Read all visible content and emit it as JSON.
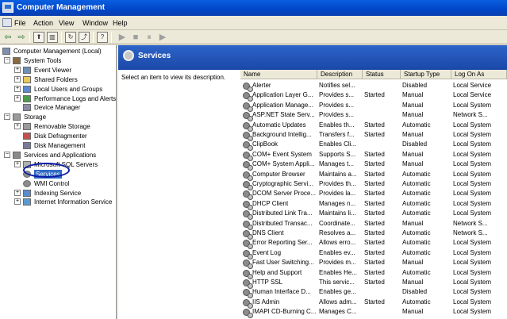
{
  "window": {
    "title": "Computer Management"
  },
  "menu": [
    "File",
    "Action",
    "View",
    "Window",
    "Help"
  ],
  "toolbar": [
    {
      "name": "back-arrow-icon",
      "glyph": "⇦"
    },
    {
      "name": "forward-arrow-icon",
      "glyph": "⇨"
    },
    {
      "name": "up-folder-icon",
      "glyph": "⬆"
    },
    {
      "name": "show-hide-tree-icon",
      "glyph": "▥"
    },
    {
      "name": "refresh-icon",
      "glyph": "↻"
    },
    {
      "name": "export-list-icon",
      "glyph": "⤴"
    },
    {
      "name": "properties-icon",
      "glyph": "?"
    },
    {
      "name": "start-service-icon",
      "glyph": "▶"
    },
    {
      "name": "stop-service-icon",
      "glyph": "■"
    },
    {
      "name": "pause-service-icon",
      "glyph": "⏸"
    },
    {
      "name": "restart-service-icon",
      "glyph": "▶"
    }
  ],
  "tree": [
    {
      "label": "Computer Management (Local)",
      "level": 0,
      "expander": "",
      "icon": "computer-icon",
      "color": "#7f8fb0"
    },
    {
      "label": "System Tools",
      "level": 1,
      "expander": "−",
      "icon": "tools-icon",
      "color": "#8b6a3c"
    },
    {
      "label": "Event Viewer",
      "level": 2,
      "expander": "+",
      "icon": "event-viewer-icon",
      "color": "#6d8fb5"
    },
    {
      "label": "Shared Folders",
      "level": 2,
      "expander": "+",
      "icon": "shared-folders-icon",
      "color": "#e8c85a"
    },
    {
      "label": "Local Users and Groups",
      "level": 2,
      "expander": "+",
      "icon": "users-icon",
      "color": "#5a8ad0"
    },
    {
      "label": "Performance Logs and Alerts",
      "level": 2,
      "expander": "+",
      "icon": "performance-icon",
      "color": "#4a9a4a"
    },
    {
      "label": "Device Manager",
      "level": 2,
      "expander": "",
      "icon": "device-manager-icon",
      "color": "#8a8aa8"
    },
    {
      "label": "Storage",
      "level": 1,
      "expander": "−",
      "icon": "storage-icon",
      "color": "#9a9a9a"
    },
    {
      "label": "Removable Storage",
      "level": 2,
      "expander": "+",
      "icon": "removable-storage-icon",
      "color": "#9a9a9a"
    },
    {
      "label": "Disk Defragmenter",
      "level": 2,
      "expander": "",
      "icon": "defrag-icon",
      "color": "#c05050"
    },
    {
      "label": "Disk Management",
      "level": 2,
      "expander": "",
      "icon": "disk-management-icon",
      "color": "#7a7a9a"
    },
    {
      "label": "Services and Applications",
      "level": 1,
      "expander": "−",
      "icon": "services-apps-icon",
      "color": "#8a8a8a"
    },
    {
      "label": "Microsoft SQL Servers",
      "level": 2,
      "expander": "+",
      "icon": "sql-server-icon",
      "color": "#b0b0b0"
    },
    {
      "label": "Services",
      "level": 2,
      "expander": "",
      "icon": "services-icon",
      "color": "#8c8c8c",
      "selected": true
    },
    {
      "label": "WMI Control",
      "level": 2,
      "expander": "",
      "icon": "wmi-icon",
      "color": "#8c8c8c"
    },
    {
      "label": "Indexing Service",
      "level": 2,
      "expander": "+",
      "icon": "indexing-icon",
      "color": "#5a8ad0"
    },
    {
      "label": "Internet Information Service",
      "level": 2,
      "expander": "+",
      "icon": "iis-icon",
      "color": "#5a9ad0"
    }
  ],
  "panel": {
    "title": "Services",
    "description_prompt": "Select an item to view its description."
  },
  "columns": [
    "Name",
    "Description",
    "Status",
    "Startup Type",
    "Log On As"
  ],
  "services": [
    [
      "Alerter",
      "Notifies sel...",
      "",
      "Disabled",
      "Local Service"
    ],
    [
      "Application Layer G...",
      "Provides s...",
      "Started",
      "Manual",
      "Local Service"
    ],
    [
      "Application Manage...",
      "Provides s...",
      "",
      "Manual",
      "Local System"
    ],
    [
      "ASP.NET State Serv...",
      "Provides s...",
      "",
      "Manual",
      "Network S..."
    ],
    [
      "Automatic Updates",
      "Enables th...",
      "Started",
      "Automatic",
      "Local System"
    ],
    [
      "Background Intellig...",
      "Transfers f...",
      "Started",
      "Manual",
      "Local System"
    ],
    [
      "ClipBook",
      "Enables Cli...",
      "",
      "Disabled",
      "Local System"
    ],
    [
      "COM+ Event System",
      "Supports S...",
      "Started",
      "Manual",
      "Local System"
    ],
    [
      "COM+ System Appli...",
      "Manages t...",
      "Started",
      "Manual",
      "Local System"
    ],
    [
      "Computer Browser",
      "Maintains a...",
      "Started",
      "Automatic",
      "Local System"
    ],
    [
      "Cryptographic Servi...",
      "Provides th...",
      "Started",
      "Automatic",
      "Local System"
    ],
    [
      "DCOM Server Proce...",
      "Provides la...",
      "Started",
      "Automatic",
      "Local System"
    ],
    [
      "DHCP Client",
      "Manages n...",
      "Started",
      "Automatic",
      "Local System"
    ],
    [
      "Distributed Link Tra...",
      "Maintains li...",
      "Started",
      "Automatic",
      "Local System"
    ],
    [
      "Distributed Transac...",
      "Coordinate...",
      "Started",
      "Manual",
      "Network S..."
    ],
    [
      "DNS Client",
      "Resolves a...",
      "Started",
      "Automatic",
      "Network S..."
    ],
    [
      "Error Reporting Ser...",
      "Allows erro...",
      "Started",
      "Automatic",
      "Local System"
    ],
    [
      "Event Log",
      "Enables ev...",
      "Started",
      "Automatic",
      "Local System"
    ],
    [
      "Fast User Switching...",
      "Provides m...",
      "Started",
      "Manual",
      "Local System"
    ],
    [
      "Help and Support",
      "Enables He...",
      "Started",
      "Automatic",
      "Local System"
    ],
    [
      "HTTP SSL",
      "This servic...",
      "Started",
      "Manual",
      "Local System"
    ],
    [
      "Human Interface D...",
      "Enables ge...",
      "",
      "Disabled",
      "Local System"
    ],
    [
      "IIS Admin",
      "Allows adm...",
      "Started",
      "Automatic",
      "Local System"
    ],
    [
      "IMAPI CD-Burning C...",
      "Manages C...",
      "",
      "Manual",
      "Local System"
    ]
  ]
}
